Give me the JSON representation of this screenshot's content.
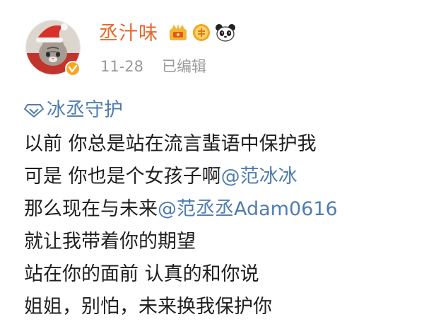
{
  "post": {
    "username": "丞汁味",
    "timestamp": "11-28",
    "edited_label": "已编辑",
    "topic": "冰丞守护",
    "content_lines": [
      {
        "text": "以前 你总是站在流言蜚语中保护我"
      },
      {
        "text": "可是 你也是个女孩子啊",
        "mention": "@范冰冰"
      },
      {
        "text": "那么现在与未来",
        "mention": "@范丞丞Adam0616"
      },
      {
        "text": "就让我带着你的期望"
      },
      {
        "text": "站在你的面前 认真的和你说"
      },
      {
        "text": "姐姐，别怕，未来换我保护你"
      }
    ]
  },
  "icons": {
    "avatar": "cat-with-santa-hat-avatar",
    "verified": "verified-badge-icon",
    "badges": [
      "crown-level-icon",
      "fan-badge-icon",
      "panda-icon"
    ],
    "topic": "diamond-topic-icon"
  },
  "colors": {
    "username": "#e8672a",
    "link": "#507daf",
    "meta": "#9a9a9a",
    "text": "#1f1f1f"
  }
}
